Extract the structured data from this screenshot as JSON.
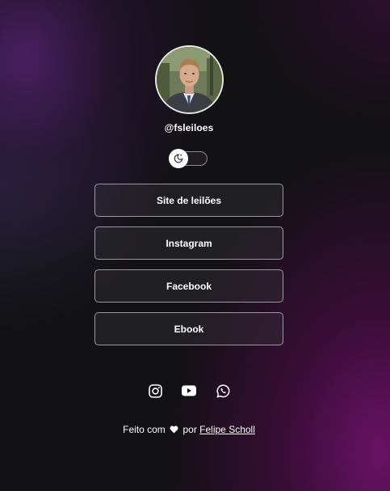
{
  "profile": {
    "handle": "@fsleiloes",
    "avatar_alt": "profile photo"
  },
  "theme_toggle": {
    "icon": "moon-sun-icon",
    "state": "off"
  },
  "links": [
    {
      "label": "Site de leilões"
    },
    {
      "label": "Instagram"
    },
    {
      "label": "Facebook"
    },
    {
      "label": "Ebook"
    }
  ],
  "socials": [
    {
      "icon": "instagram-icon"
    },
    {
      "icon": "youtube-icon"
    },
    {
      "icon": "whatsapp-icon"
    }
  ],
  "footer": {
    "prefix": "Feito com",
    "middle": "por",
    "author": "Felipe Scholl"
  },
  "colors": {
    "background": "#121114",
    "accent_magenta": "#6e1269",
    "accent_violet": "#50206a",
    "button_border": "#9c97a0",
    "text": "#ffffff"
  }
}
